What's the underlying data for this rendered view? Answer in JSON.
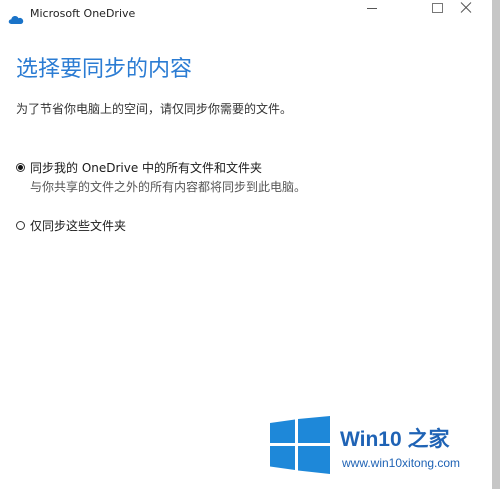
{
  "window": {
    "title": "Microsoft OneDrive",
    "app_icon": "onedrive-cloud-icon",
    "controls": {
      "minimize": "minimize-icon",
      "maximize": "maximize-icon",
      "close": "close-icon"
    }
  },
  "content": {
    "heading": "选择要同步的内容",
    "description": "为了节省你电脑上的空间，请仅同步你需要的文件。",
    "options": [
      {
        "label": "同步我的 OneDrive 中的所有文件和文件夹",
        "sublabel": "与你共享的文件之外的所有内容都将同步到此电脑。",
        "selected": true
      },
      {
        "label": "仅同步这些文件夹",
        "selected": false
      }
    ]
  },
  "watermark": {
    "title": "Win10 之家",
    "url": "www.win10xitong.com"
  },
  "colors": {
    "accent": "#2b7cd3",
    "watermark_blue": "#1f63b5",
    "onedrive_blue": "#1a73c8"
  }
}
